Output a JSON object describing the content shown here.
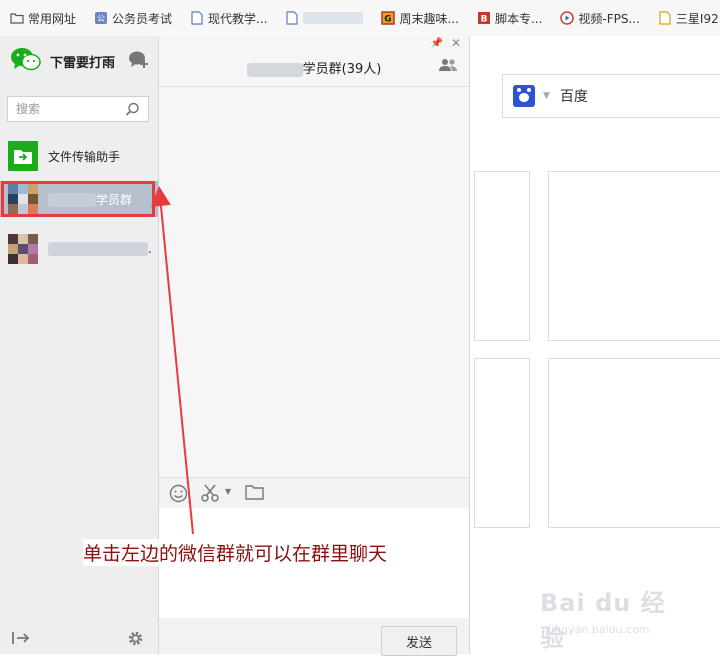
{
  "bookmarks": [
    {
      "label": "常用网址",
      "icon": "folder-icon"
    },
    {
      "label": "公务员考试",
      "icon": "site-icon"
    },
    {
      "label": "现代教学...",
      "icon": "page-icon"
    },
    {
      "label": "",
      "icon": "page-icon",
      "blurred": true
    },
    {
      "label": "周末趣味...",
      "icon": "game-icon"
    },
    {
      "label": "脚本专...",
      "icon": "script-icon"
    },
    {
      "label": "视频-FPS...",
      "icon": "play-icon"
    },
    {
      "label": "三星I92",
      "icon": "page-icon"
    }
  ],
  "wechat": {
    "user_name": "下雷要打雨",
    "search_placeholder": "搜索",
    "contacts": [
      {
        "name": "文件传输助手",
        "selected": false,
        "avatar": "file-transfer-icon"
      },
      {
        "name": "学员群",
        "selected": true,
        "avatar": "group-avatar"
      },
      {
        "name": ".",
        "selected": false,
        "avatar": "group-avatar"
      }
    ],
    "chat_title": "学员群(39人)",
    "send_label": "发送"
  },
  "browser": {
    "search_engine": "百度"
  },
  "annotation": "单击左边的微信群就可以在群里聊天",
  "watermark": {
    "logo": "Bai du 经验",
    "url": "jingyan.baidu.com"
  },
  "colors": {
    "wechat_green": "#1aad19",
    "selected_bg": "#b6bfcc",
    "highlight_red": "#e83b3b",
    "annotation_text": "#8a1010"
  }
}
